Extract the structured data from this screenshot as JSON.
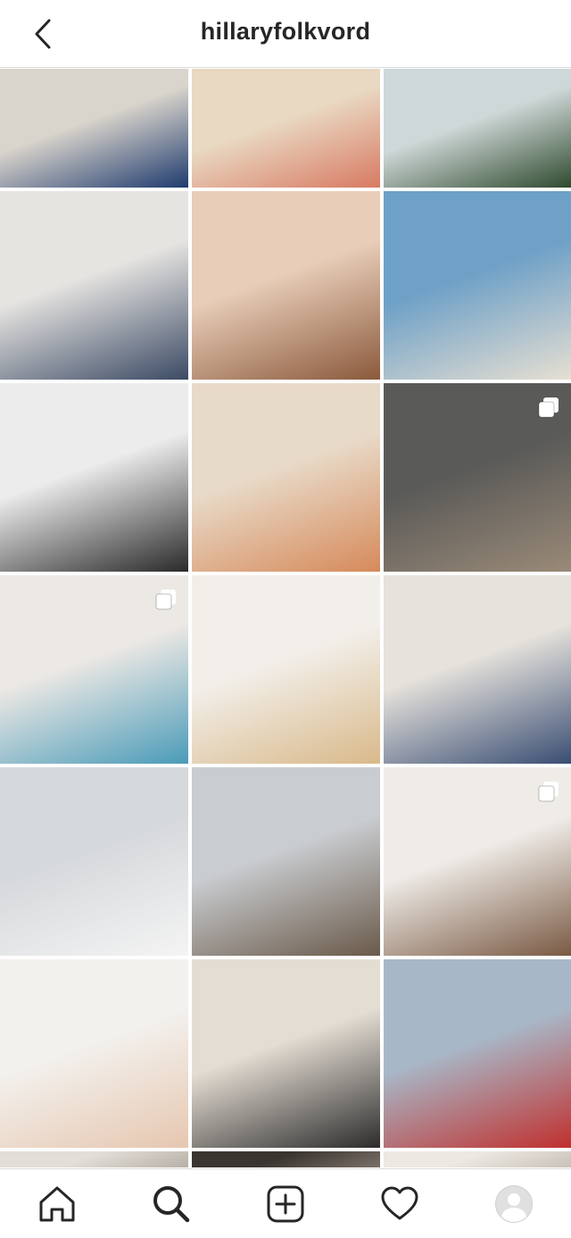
{
  "header": {
    "title": "hillaryfolkvord",
    "back_icon": "chevron-left-icon"
  },
  "grid": {
    "tiles": [
      {
        "name": "post-woman-striped-top",
        "multi": false,
        "colors": [
          "#d9d4cc",
          "#1f3b6e"
        ]
      },
      {
        "name": "post-mother-child-beach",
        "multi": false,
        "colors": [
          "#e9d8c2",
          "#d87a62"
        ]
      },
      {
        "name": "post-woman-field-picnic",
        "multi": false,
        "colors": [
          "#cfd8d8",
          "#2f4a2e"
        ]
      },
      {
        "name": "post-couple-portrait",
        "multi": false,
        "colors": [
          "#e6e4e1",
          "#3b4a64"
        ]
      },
      {
        "name": "post-woman-sunglasses-selfie",
        "multi": false,
        "colors": [
          "#e8cdb8",
          "#8b5a3c"
        ]
      },
      {
        "name": "post-beach-umbrellas",
        "multi": false,
        "colors": [
          "#6fa1c7",
          "#e6dfd2"
        ]
      },
      {
        "name": "post-family-black-white",
        "multi": false,
        "colors": [
          "#ececec",
          "#2a2a2a"
        ]
      },
      {
        "name": "post-fruit-bowl-table",
        "multi": false,
        "colors": [
          "#e8dac8",
          "#d68a5a"
        ]
      },
      {
        "name": "post-family-outdoor",
        "multi": true,
        "colors": [
          "#5a5a58",
          "#9a8a78"
        ]
      },
      {
        "name": "post-baby-cake-smash",
        "multi": true,
        "colors": [
          "#ece8e4",
          "#4a9bb8"
        ]
      },
      {
        "name": "post-mother-baby-bed",
        "multi": false,
        "colors": [
          "#f2efea",
          "#d9b98a"
        ]
      },
      {
        "name": "post-mirror-selfie",
        "multi": false,
        "colors": [
          "#e6e2dc",
          "#3a4e73"
        ]
      },
      {
        "name": "post-skier-snow",
        "multi": false,
        "colors": [
          "#d6d9dc",
          "#f4f4f4"
        ]
      },
      {
        "name": "post-baby-window",
        "multi": false,
        "colors": [
          "#c9ccd0",
          "#6a5a4a"
        ]
      },
      {
        "name": "post-white-kitchen",
        "multi": true,
        "colors": [
          "#efece8",
          "#7a5a44"
        ]
      },
      {
        "name": "post-baby-kiss-mark",
        "multi": false,
        "colors": [
          "#f3f1ee",
          "#e6c7b0"
        ]
      },
      {
        "name": "post-woman-striped-shirt-bed",
        "multi": false,
        "colors": [
          "#e4ddd3",
          "#2c2c2c"
        ]
      },
      {
        "name": "post-baby-henry-sign",
        "multi": false,
        "colors": [
          "#a8b7c7",
          "#c0302e"
        ]
      },
      {
        "name": "post-partial-1",
        "multi": false,
        "colors": [
          "#e2ded8",
          "#b7b0a6"
        ]
      },
      {
        "name": "post-partial-2",
        "multi": true,
        "colors": [
          "#3a3530",
          "#7a7068"
        ]
      },
      {
        "name": "post-partial-3",
        "multi": false,
        "colors": [
          "#ece8e2",
          "#c9c2b8"
        ]
      }
    ]
  },
  "tabbar": {
    "items": [
      {
        "name": "tab-home",
        "icon": "home-icon"
      },
      {
        "name": "tab-search",
        "icon": "search-icon"
      },
      {
        "name": "tab-new-post",
        "icon": "plus-square-icon"
      },
      {
        "name": "tab-activity",
        "icon": "heart-icon"
      },
      {
        "name": "tab-profile",
        "icon": "avatar-icon"
      }
    ]
  }
}
